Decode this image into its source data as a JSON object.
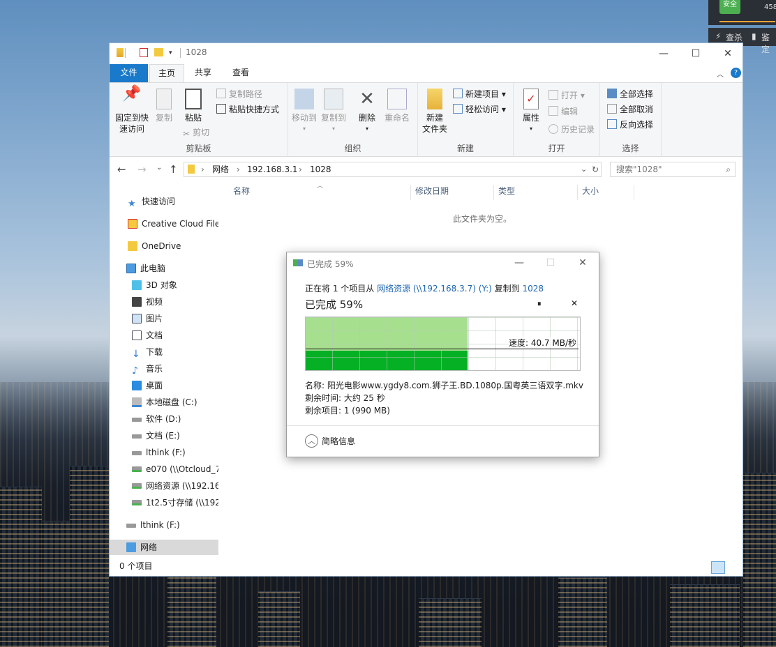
{
  "desktop": {
    "top_right_num": "458",
    "top_right_badge": "安全",
    "tray_items": [
      "查杀",
      "鉴定"
    ]
  },
  "explorer": {
    "title": "1028",
    "window_controls": {
      "minimize": "—",
      "maximize": "☐",
      "close": "✕"
    },
    "tabs": {
      "file": "文件",
      "home": "主页",
      "share": "共享",
      "view": "查看"
    },
    "ribbon": {
      "clipboard": {
        "group": "剪贴板",
        "pin": "固定到快速访问",
        "pin_line1": "固定到快",
        "pin_line2": "速访问",
        "copy": "复制",
        "paste": "粘贴",
        "copy_path": "复制路径",
        "paste_shortcut": "粘贴快捷方式",
        "cut": "剪切"
      },
      "organize": {
        "group": "组织",
        "move_to": "移动到",
        "copy_to": "复制到",
        "delete": "删除",
        "rename": "重命名"
      },
      "new": {
        "group": "新建",
        "new_folder_1": "新建",
        "new_folder_2": "文件夹",
        "new_item": "新建项目",
        "easy_access": "轻松访问"
      },
      "open": {
        "group": "打开",
        "properties": "属性",
        "open": "打开",
        "edit": "编辑",
        "history": "历史记录"
      },
      "select": {
        "group": "选择",
        "select_all": "全部选择",
        "select_none": "全部取消",
        "invert": "反向选择"
      }
    },
    "address": {
      "crumbs": [
        "网络",
        "192.168.3.1",
        "1028"
      ],
      "search_placeholder": "搜索\"1028\""
    },
    "sidebar": {
      "quick_access": "快速访问",
      "creative_cloud": "Creative Cloud Files",
      "onedrive": "OneDrive",
      "this_pc": "此电脑",
      "objects3d": "3D 对象",
      "videos": "视频",
      "pictures": "图片",
      "documents": "文档",
      "downloads": "下载",
      "music": "音乐",
      "desktop": "桌面",
      "local_c": "本地磁盘 (C:)",
      "soft_d": "软件 (D:)",
      "doc_e": "文档 (E:)",
      "lthink_f": "lthink (F:)",
      "e070": "e070 (\\\\Otcloud_7",
      "netres": "网络资源 (\\\\192.16",
      "store": "1t2.5寸存储 (\\\\192",
      "lthink_f2": "lthink (F:)",
      "network": "网络"
    },
    "columns": {
      "name": "名称",
      "date": "修改日期",
      "type": "类型",
      "size": "大小"
    },
    "empty_text": "此文件夹为空。",
    "status": "0 个项目"
  },
  "copy_dialog": {
    "title": "已完成 59%",
    "line_prefix": "正在将 1 个项目从",
    "source": "网络资源 (\\\\192.168.3.7) (Y:)",
    "copy_to": "复制到",
    "dest": "1028",
    "progress_label": "已完成 59%",
    "speed": "速度: 40.7 MB/秒",
    "name_label": "名称: 阳光电影www.ygdy8.com.狮子王.BD.1080p.国粤英三语双字.mkv",
    "time_label": "剩余时间: 大约 25 秒",
    "items_label": "剩余项目: 1 (990 MB)",
    "details_toggle": "简略信息",
    "pause": "⏸",
    "cancel": "✕",
    "minimize": "—",
    "maximize": "☐",
    "close": "✕"
  },
  "colors": {
    "accent": "#1979ca",
    "progress_fill": "#a6e08f",
    "speed_fill": "#06b025",
    "link": "#1e66b0"
  },
  "progress": 0.59
}
